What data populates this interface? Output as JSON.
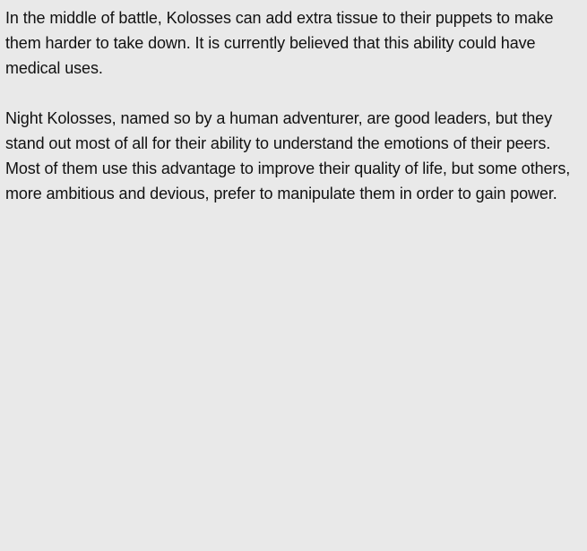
{
  "paragraphs": [
    "In the middle of battle, Kolosses can add extra tissue to their puppets to make them harder to take down. It is currently believed that this ability could have medical uses.",
    "Night Kolosses, named so by a human adventurer, are good leaders, but they stand out most of all for their ability to understand the emotions of their peers. Most of them use this advantage to improve their quality of life, but some others, more ambitious and devious, prefer to manipulate them in order to gain power."
  ],
  "colors": {
    "background": "#e9e9e9",
    "text": "#111111"
  }
}
